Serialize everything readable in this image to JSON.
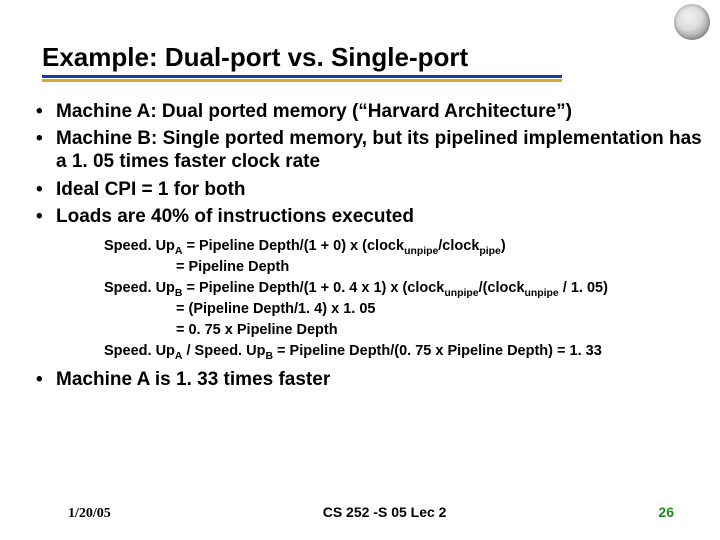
{
  "logo": {
    "name": "seal-icon"
  },
  "title": "Example: Dual-port vs. Single-port",
  "bullets_top": [
    "Machine A: Dual ported memory (“Harvard Architecture”)",
    "Machine B: Single ported memory, but its pipelined implementation has a 1. 05 times faster clock rate",
    "Ideal CPI = 1 for both",
    "Loads are 40% of instructions executed"
  ],
  "calc": {
    "l1a": "Speed. Up",
    "l1a_sub": "A",
    "l1b": " = Pipeline Depth/(1 + 0) x (clock",
    "l1b_sub": "unpipe",
    "l1c": "/clock",
    "l1c_sub": "pipe",
    "l1d": ")",
    "l2": "= Pipeline Depth",
    "l3a": "Speed. Up",
    "l3a_sub": "B",
    "l3b": " = Pipeline Depth/(1 + 0. 4 x 1) x (clock",
    "l3b_sub": "unpipe",
    "l3c": "/(clock",
    "l3c_sub": "unpipe",
    "l3d": " / 1. 05)",
    "l4": "= (Pipeline Depth/1. 4) x  1. 05",
    "l5": "= 0. 75 x Pipeline Depth",
    "l6a": "Speed. Up",
    "l6a_sub": "A",
    "l6b": " / Speed. Up",
    "l6b_sub": "B",
    "l6c": " = Pipeline Depth/(0. 75 x Pipeline Depth) = 1. 33"
  },
  "bullets_bottom": [
    "Machine A is 1. 33 times faster"
  ],
  "footer": {
    "date": "1/20/05",
    "course": "CS 252 -S 05 Lec 2",
    "page": "26"
  }
}
